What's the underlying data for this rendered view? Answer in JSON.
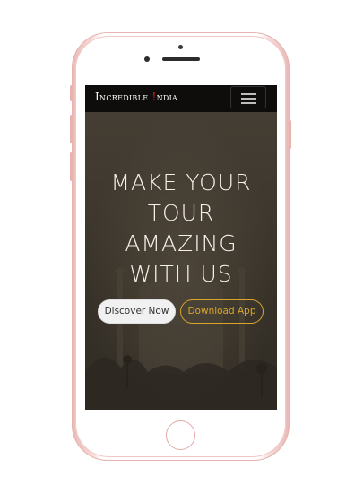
{
  "brand": {
    "name_prefix": "Incredible ",
    "name_accent": "!",
    "name_suffix": "ndia"
  },
  "hero": {
    "headline_lines": [
      "MAKE YOUR",
      "TOUR",
      "AMAZING",
      "WITH US"
    ]
  },
  "buttons": {
    "discover_label": "Discover Now",
    "download_label": "Download App"
  },
  "colors": {
    "navbar_bg": "#0e0d0c",
    "accent_red": "#e3201b",
    "download_accent": "#d9a52a",
    "phone_frame": "#e9b9b6"
  },
  "icons": {
    "menu": "hamburger-icon"
  }
}
